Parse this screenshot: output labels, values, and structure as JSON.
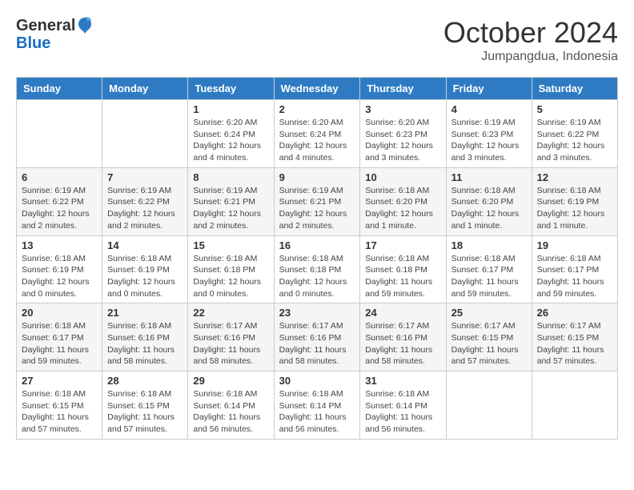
{
  "logo": {
    "general": "General",
    "blue": "Blue"
  },
  "title": "October 2024",
  "location": "Jumpangdua, Indonesia",
  "days_of_week": [
    "Sunday",
    "Monday",
    "Tuesday",
    "Wednesday",
    "Thursday",
    "Friday",
    "Saturday"
  ],
  "weeks": [
    [
      {
        "day": "",
        "detail": ""
      },
      {
        "day": "",
        "detail": ""
      },
      {
        "day": "1",
        "detail": "Sunrise: 6:20 AM\nSunset: 6:24 PM\nDaylight: 12 hours and 4 minutes."
      },
      {
        "day": "2",
        "detail": "Sunrise: 6:20 AM\nSunset: 6:24 PM\nDaylight: 12 hours and 4 minutes."
      },
      {
        "day": "3",
        "detail": "Sunrise: 6:20 AM\nSunset: 6:23 PM\nDaylight: 12 hours and 3 minutes."
      },
      {
        "day": "4",
        "detail": "Sunrise: 6:19 AM\nSunset: 6:23 PM\nDaylight: 12 hours and 3 minutes."
      },
      {
        "day": "5",
        "detail": "Sunrise: 6:19 AM\nSunset: 6:22 PM\nDaylight: 12 hours and 3 minutes."
      }
    ],
    [
      {
        "day": "6",
        "detail": "Sunrise: 6:19 AM\nSunset: 6:22 PM\nDaylight: 12 hours and 2 minutes."
      },
      {
        "day": "7",
        "detail": "Sunrise: 6:19 AM\nSunset: 6:22 PM\nDaylight: 12 hours and 2 minutes."
      },
      {
        "day": "8",
        "detail": "Sunrise: 6:19 AM\nSunset: 6:21 PM\nDaylight: 12 hours and 2 minutes."
      },
      {
        "day": "9",
        "detail": "Sunrise: 6:19 AM\nSunset: 6:21 PM\nDaylight: 12 hours and 2 minutes."
      },
      {
        "day": "10",
        "detail": "Sunrise: 6:18 AM\nSunset: 6:20 PM\nDaylight: 12 hours and 1 minute."
      },
      {
        "day": "11",
        "detail": "Sunrise: 6:18 AM\nSunset: 6:20 PM\nDaylight: 12 hours and 1 minute."
      },
      {
        "day": "12",
        "detail": "Sunrise: 6:18 AM\nSunset: 6:19 PM\nDaylight: 12 hours and 1 minute."
      }
    ],
    [
      {
        "day": "13",
        "detail": "Sunrise: 6:18 AM\nSunset: 6:19 PM\nDaylight: 12 hours and 0 minutes."
      },
      {
        "day": "14",
        "detail": "Sunrise: 6:18 AM\nSunset: 6:19 PM\nDaylight: 12 hours and 0 minutes."
      },
      {
        "day": "15",
        "detail": "Sunrise: 6:18 AM\nSunset: 6:18 PM\nDaylight: 12 hours and 0 minutes."
      },
      {
        "day": "16",
        "detail": "Sunrise: 6:18 AM\nSunset: 6:18 PM\nDaylight: 12 hours and 0 minutes."
      },
      {
        "day": "17",
        "detail": "Sunrise: 6:18 AM\nSunset: 6:18 PM\nDaylight: 11 hours and 59 minutes."
      },
      {
        "day": "18",
        "detail": "Sunrise: 6:18 AM\nSunset: 6:17 PM\nDaylight: 11 hours and 59 minutes."
      },
      {
        "day": "19",
        "detail": "Sunrise: 6:18 AM\nSunset: 6:17 PM\nDaylight: 11 hours and 59 minutes."
      }
    ],
    [
      {
        "day": "20",
        "detail": "Sunrise: 6:18 AM\nSunset: 6:17 PM\nDaylight: 11 hours and 59 minutes."
      },
      {
        "day": "21",
        "detail": "Sunrise: 6:18 AM\nSunset: 6:16 PM\nDaylight: 11 hours and 58 minutes."
      },
      {
        "day": "22",
        "detail": "Sunrise: 6:17 AM\nSunset: 6:16 PM\nDaylight: 11 hours and 58 minutes."
      },
      {
        "day": "23",
        "detail": "Sunrise: 6:17 AM\nSunset: 6:16 PM\nDaylight: 11 hours and 58 minutes."
      },
      {
        "day": "24",
        "detail": "Sunrise: 6:17 AM\nSunset: 6:16 PM\nDaylight: 11 hours and 58 minutes."
      },
      {
        "day": "25",
        "detail": "Sunrise: 6:17 AM\nSunset: 6:15 PM\nDaylight: 11 hours and 57 minutes."
      },
      {
        "day": "26",
        "detail": "Sunrise: 6:17 AM\nSunset: 6:15 PM\nDaylight: 11 hours and 57 minutes."
      }
    ],
    [
      {
        "day": "27",
        "detail": "Sunrise: 6:18 AM\nSunset: 6:15 PM\nDaylight: 11 hours and 57 minutes."
      },
      {
        "day": "28",
        "detail": "Sunrise: 6:18 AM\nSunset: 6:15 PM\nDaylight: 11 hours and 57 minutes."
      },
      {
        "day": "29",
        "detail": "Sunrise: 6:18 AM\nSunset: 6:14 PM\nDaylight: 11 hours and 56 minutes."
      },
      {
        "day": "30",
        "detail": "Sunrise: 6:18 AM\nSunset: 6:14 PM\nDaylight: 11 hours and 56 minutes."
      },
      {
        "day": "31",
        "detail": "Sunrise: 6:18 AM\nSunset: 6:14 PM\nDaylight: 11 hours and 56 minutes."
      },
      {
        "day": "",
        "detail": ""
      },
      {
        "day": "",
        "detail": ""
      }
    ]
  ]
}
